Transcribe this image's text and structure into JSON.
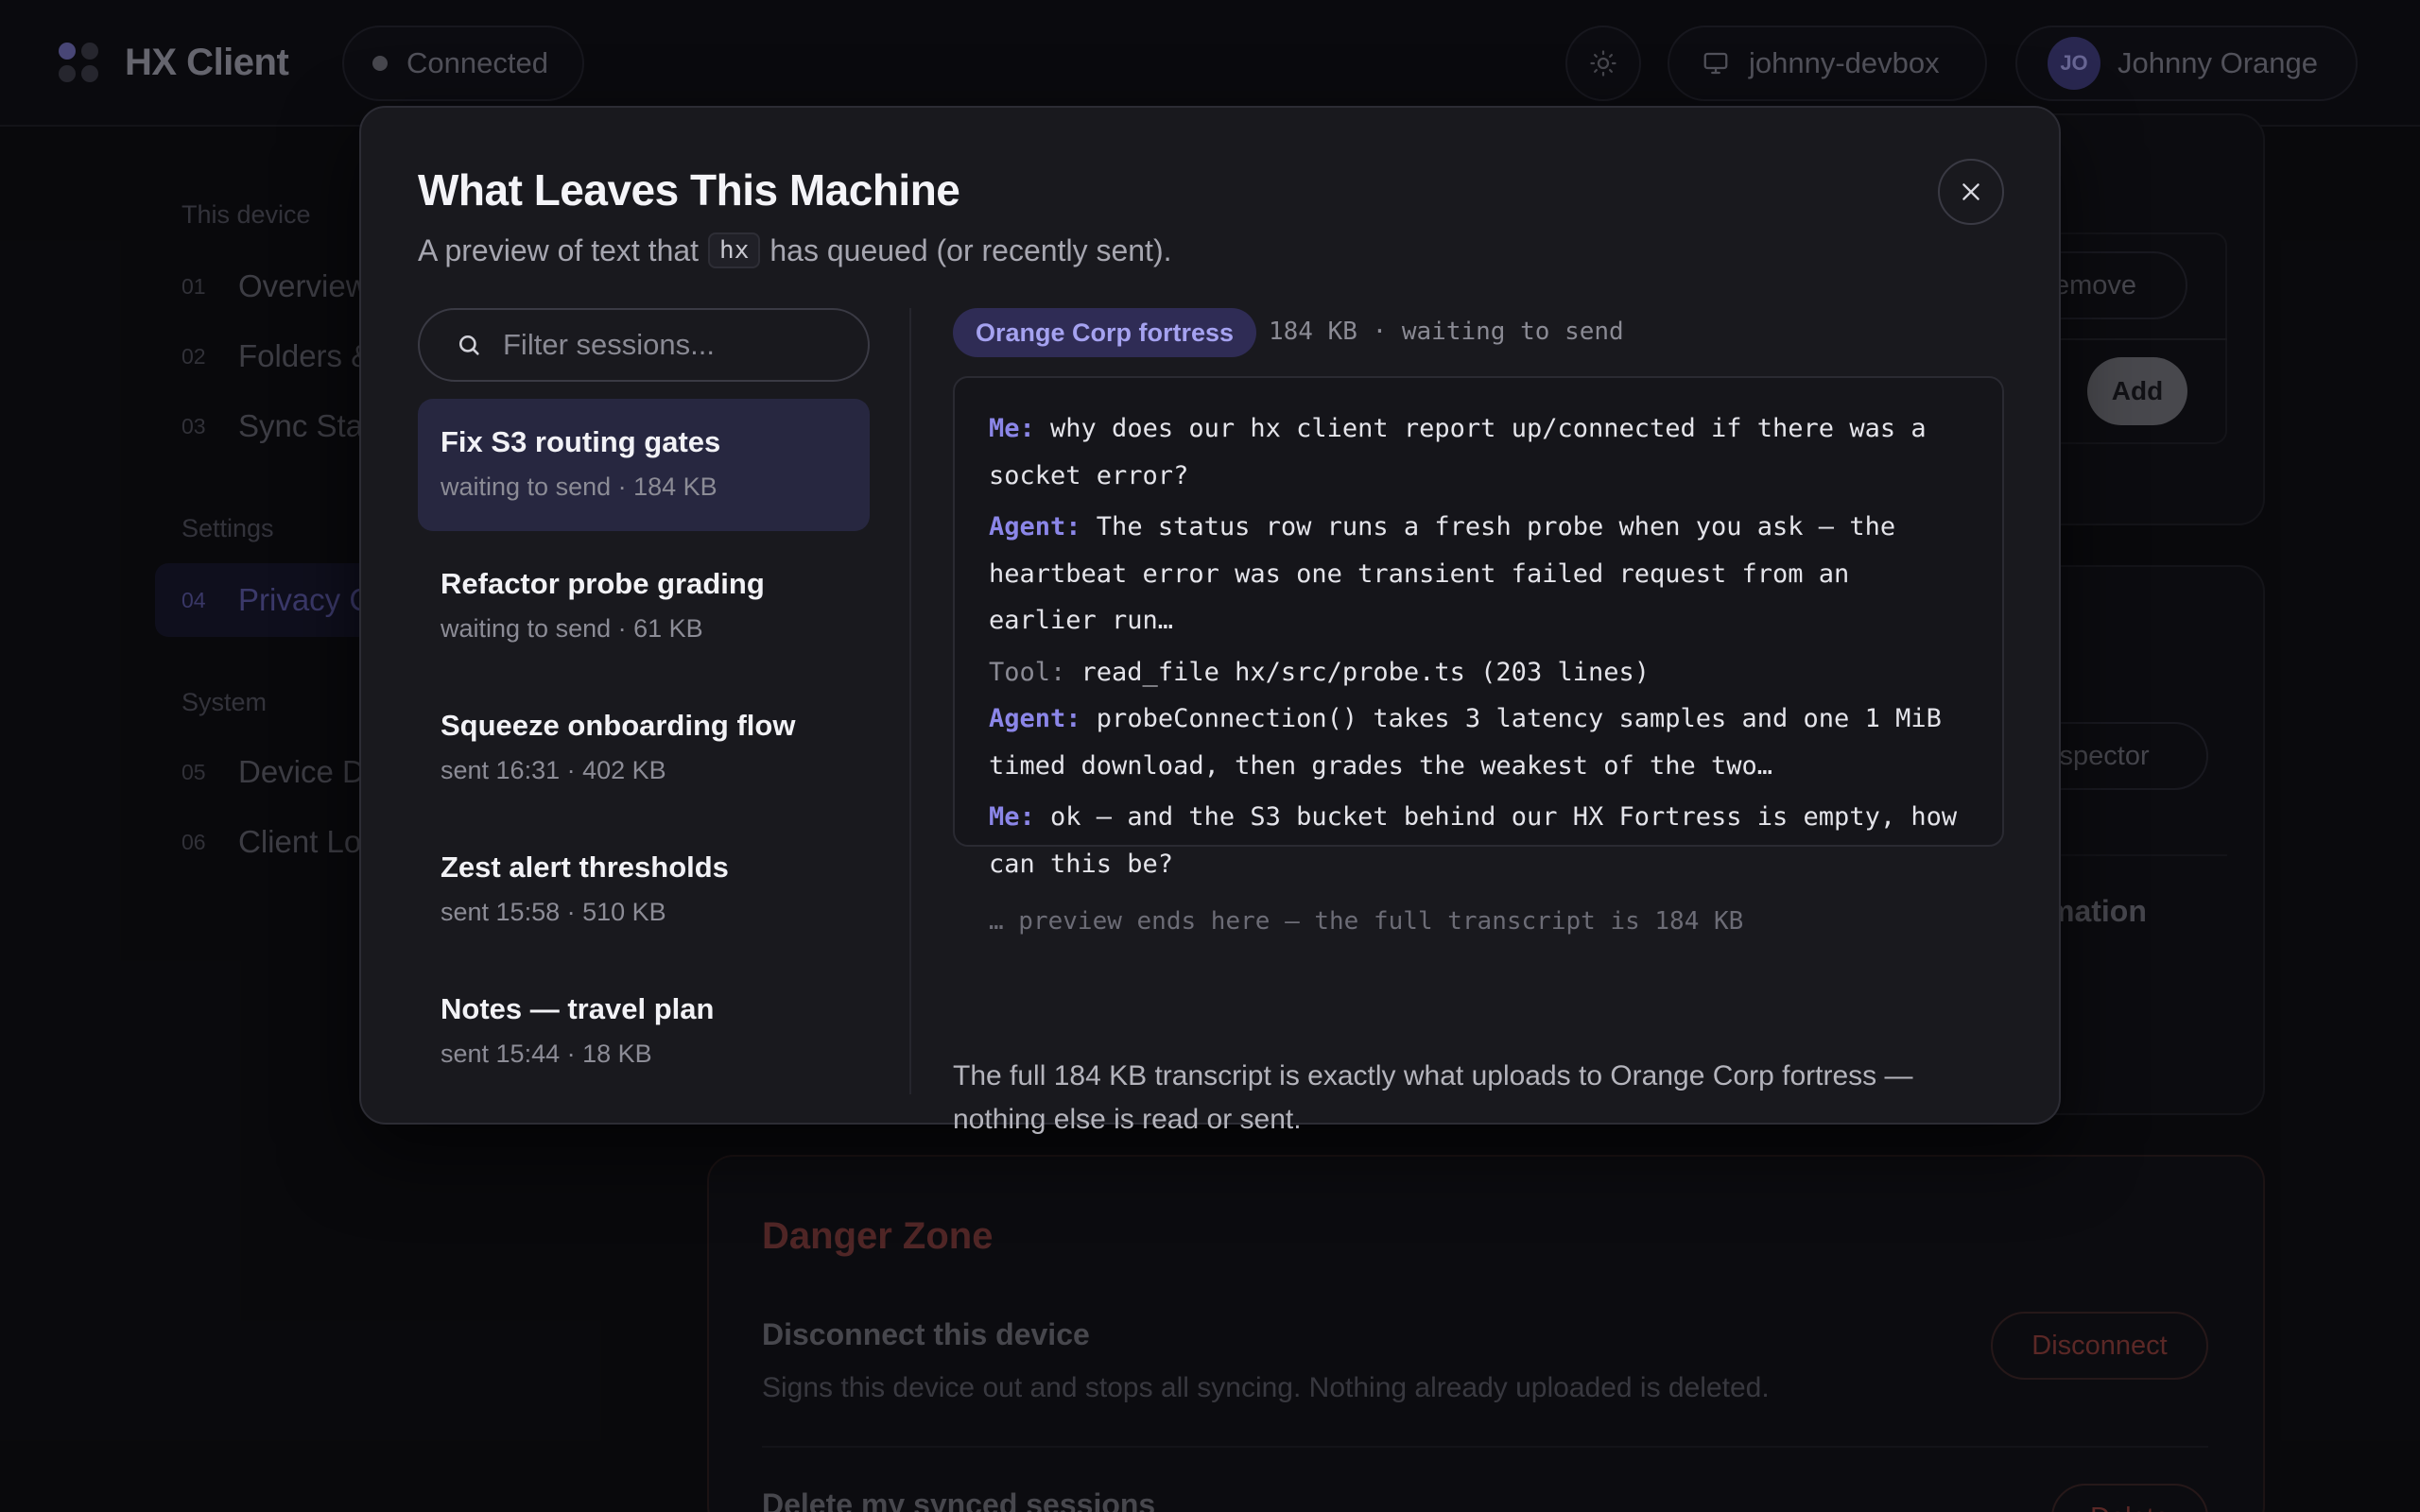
{
  "app": {
    "name": "HX Client",
    "status": "Connected",
    "device": "johnny-devbox",
    "user": {
      "initials": "JO",
      "name": "Johnny Orange"
    }
  },
  "sidebar": {
    "groups": [
      {
        "label": "This device"
      },
      {
        "label": "Settings"
      },
      {
        "label": "System"
      }
    ],
    "items": [
      {
        "num": "01",
        "label": "Overview"
      },
      {
        "num": "02",
        "label": "Folders &"
      },
      {
        "num": "03",
        "label": "Sync Sta"
      },
      {
        "num": "04",
        "label": "Privacy C"
      },
      {
        "num": "05",
        "label": "Device D"
      },
      {
        "num": "06",
        "label": "Client Lo"
      }
    ]
  },
  "background": {
    "remove_label": "Remove",
    "add_label": "Add",
    "inspector_label": "nspector",
    "mation_text": "mation",
    "danger": {
      "title": "Danger Zone",
      "disconnect_title": "Disconnect this device",
      "disconnect_desc": "Signs this device out and stops all syncing. Nothing already uploaded is deleted.",
      "disconnect_label": "Disconnect",
      "delete_title": "Delete my synced sessions",
      "delete_label": "Delete"
    }
  },
  "modal": {
    "title": "What Leaves This Machine",
    "subtitle_before": "A preview of text that",
    "subtitle_code": "hx",
    "subtitle_after": "has queued (or recently sent).",
    "search_placeholder": "Filter sessions...",
    "sessions": [
      {
        "title": "Fix S3 routing gates",
        "meta": "waiting to send · 184 KB"
      },
      {
        "title": "Refactor probe grading",
        "meta": "waiting to send · 61 KB"
      },
      {
        "title": "Squeeze onboarding flow",
        "meta": "sent 16:31 · 402 KB"
      },
      {
        "title": "Zest alert thresholds",
        "meta": "sent 15:58 · 510 KB"
      },
      {
        "title": "Notes — travel plan",
        "meta": "sent 15:44 · 18 KB"
      }
    ],
    "target": "Orange Corp fortress",
    "target_meta": "184 KB · waiting to send",
    "transcript": [
      {
        "speaker": "Me:",
        "text": " why does our hx client report up/connected if there was a"
      },
      {
        "speaker": "",
        "text": "socket error?"
      },
      {
        "speaker": "Agent:",
        "text": " The status row runs a fresh probe when you ask — the"
      },
      {
        "speaker": "",
        "text": "heartbeat error was one transient failed request from an"
      },
      {
        "speaker": "",
        "text": "earlier run…"
      },
      {
        "speaker": "Tool:",
        "text": " read_file  hx/src/probe.ts  (203 lines)"
      },
      {
        "speaker": "Agent:",
        "text": " probeConnection() takes 3 latency samples and one 1 MiB"
      },
      {
        "speaker": "",
        "text": "timed download, then grades the weakest of the two…"
      },
      {
        "speaker": "Me:",
        "text": " ok — and the S3 bucket behind our HX Fortress is empty, how"
      },
      {
        "speaker": "",
        "text": "can this be?"
      }
    ],
    "preview_end": "… preview ends here — the full transcript is 184 KB",
    "footnote": "The full 184 KB transcript is exactly what uploads to Orange Corp fortress — nothing else is read or sent."
  }
}
